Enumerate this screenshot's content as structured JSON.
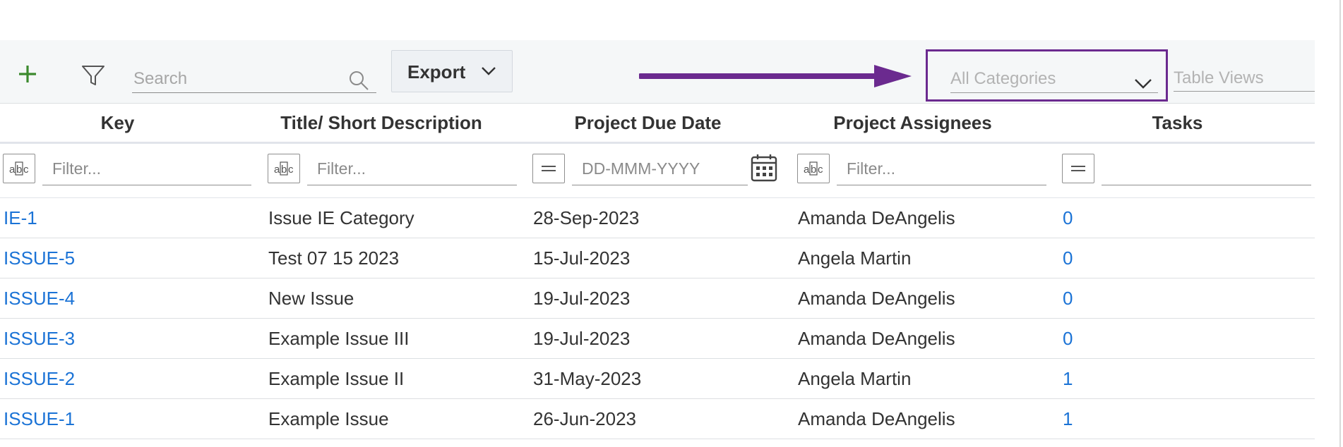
{
  "toolbar": {
    "search_placeholder": "Search",
    "export_label": "Export",
    "categories_placeholder": "All Categories",
    "table_views_placeholder": "Table Views"
  },
  "colors": {
    "accent_green": "#3c8a2e",
    "highlight_purple": "#6b2a8f",
    "link_blue": "#1b73d6"
  },
  "table": {
    "columns": [
      "Key",
      "Title/ Short Description",
      "Project Due Date",
      "Project Assignees",
      "Tasks"
    ],
    "filters": {
      "text_placeholder": "Filter...",
      "date_placeholder": "DD-MMM-YYYY"
    },
    "rows": [
      {
        "key": "IE-1",
        "title": "Issue IE Category",
        "due": "28-Sep-2023",
        "assignee": "Amanda DeAngelis",
        "tasks": "0"
      },
      {
        "key": "ISSUE-5",
        "title": "Test 07 15 2023",
        "due": "15-Jul-2023",
        "assignee": "Angela Martin",
        "tasks": "0"
      },
      {
        "key": "ISSUE-4",
        "title": "New Issue",
        "due": "19-Jul-2023",
        "assignee": "Amanda DeAngelis",
        "tasks": "0"
      },
      {
        "key": "ISSUE-3",
        "title": "Example Issue III",
        "due": "19-Jul-2023",
        "assignee": "Amanda DeAngelis",
        "tasks": "0"
      },
      {
        "key": "ISSUE-2",
        "title": "Example Issue II",
        "due": "31-May-2023",
        "assignee": "Angela Martin",
        "tasks": "1"
      },
      {
        "key": "ISSUE-1",
        "title": "Example Issue",
        "due": "26-Jun-2023",
        "assignee": "Amanda DeAngelis",
        "tasks": "1"
      }
    ]
  }
}
